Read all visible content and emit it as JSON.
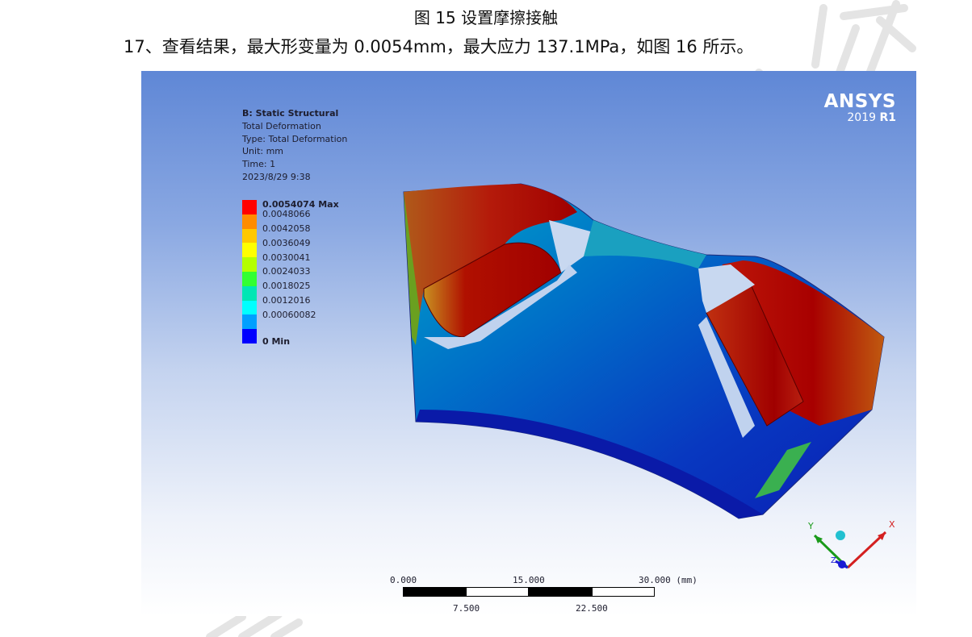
{
  "document": {
    "caption": "图 15  设置摩擦接触",
    "paragraph": "17、查看结果，最大形变量为 0.0054mm，最大应力 137.1MPa，如图 16 所示。"
  },
  "viewport": {
    "brand": "ANSYS",
    "version_main": "2019",
    "version_release": "R1",
    "info": {
      "title": "B: Static Structural",
      "result": "Total Deformation",
      "type": "Type: Total Deformation",
      "unit": "Unit: mm",
      "time": "Time: 1",
      "date": "2023/8/29 9:38"
    },
    "legend": {
      "entries": [
        {
          "label": "0.0054074 Max",
          "color": "#ff0000",
          "bold": true
        },
        {
          "label": "0.0048066",
          "color": "#ff8c00",
          "bold": false
        },
        {
          "label": "0.0042058",
          "color": "#ffc800",
          "bold": false
        },
        {
          "label": "0.0036049",
          "color": "#ffff00",
          "bold": false
        },
        {
          "label": "0.0030041",
          "color": "#b4ff00",
          "bold": false
        },
        {
          "label": "0.0024033",
          "color": "#32ff32",
          "bold": false
        },
        {
          "label": "0.0018025",
          "color": "#00e6b4",
          "bold": false
        },
        {
          "label": "0.0012016",
          "color": "#00ffff",
          "bold": false
        },
        {
          "label": "0.00060082",
          "color": "#00a0ff",
          "bold": false
        }
      ],
      "min_label": "0 Min",
      "min_color": "#0000ff"
    },
    "scale_bar": {
      "top_labels": [
        "0.000",
        "15.000",
        "30.000 (mm)"
      ],
      "bottom_labels": [
        "7.500",
        "22.500"
      ]
    },
    "triad": {
      "x_label": "X",
      "y_label": "Y",
      "z_label": "Z",
      "x_color": "#d42020",
      "y_color": "#1a9a1a",
      "z_color": "#1a1ad4"
    }
  }
}
